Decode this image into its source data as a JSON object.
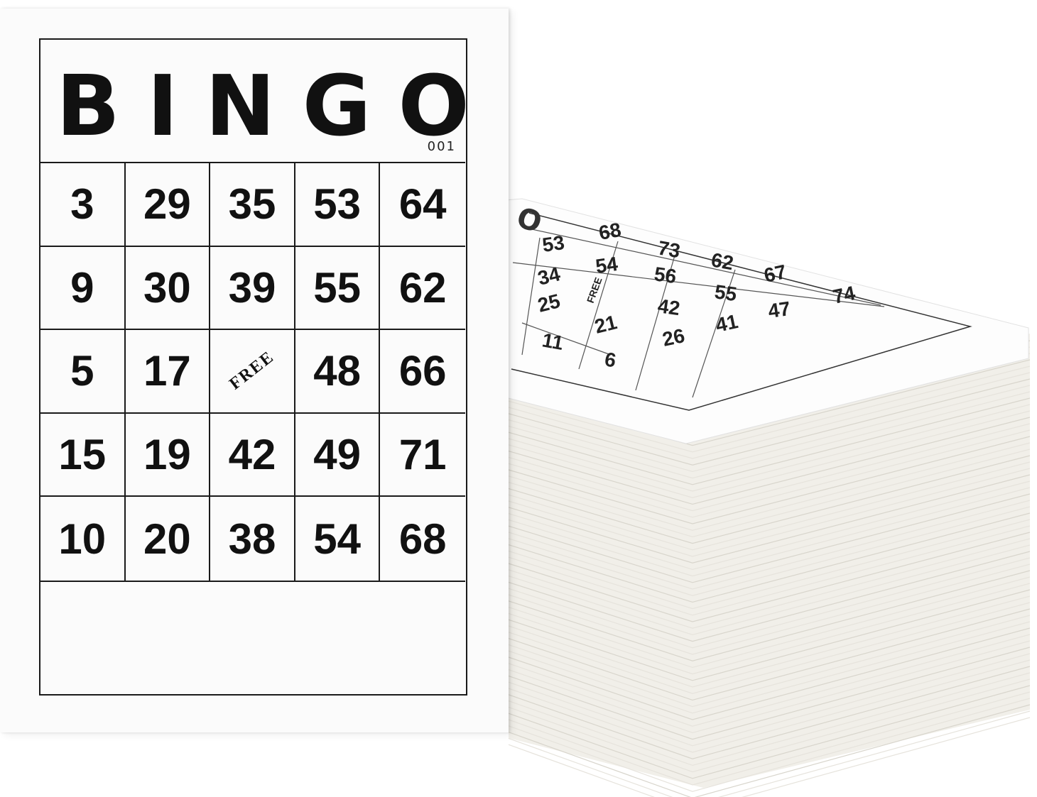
{
  "front_card": {
    "title": "BINGO",
    "serial": "001",
    "cells": [
      [
        "3",
        "29",
        "35",
        "53",
        "64"
      ],
      [
        "9",
        "30",
        "39",
        "55",
        "62"
      ],
      [
        "5",
        "17",
        "FREE",
        "48",
        "66"
      ],
      [
        "15",
        "19",
        "42",
        "49",
        "71"
      ],
      [
        "10",
        "20",
        "38",
        "54",
        "68"
      ]
    ]
  },
  "back_card": {
    "visible_numbers": [
      "53",
      "68",
      "73",
      "34",
      "54",
      "56",
      "62",
      "67",
      "25",
      "FREE",
      "42",
      "55",
      "74",
      "21",
      "47",
      "11",
      "41",
      "26",
      "6"
    ]
  },
  "colors": {
    "ink": "#111111",
    "card": "#fbfbfb",
    "card_edge": "#e8e6df"
  }
}
